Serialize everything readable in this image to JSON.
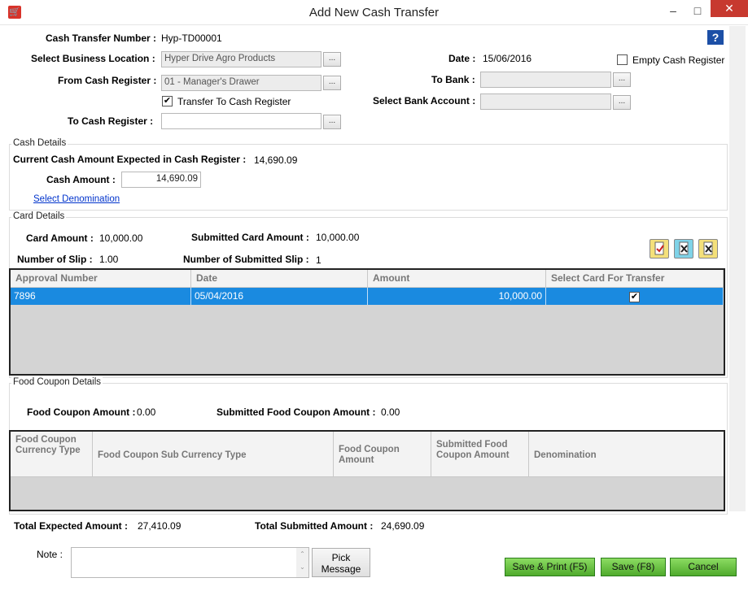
{
  "window": {
    "title": "Add New Cash Transfer",
    "minimize": "–",
    "maximize": "□",
    "close": "✕"
  },
  "header": {
    "transfer_number_label": "Cash Transfer Number :",
    "transfer_number_value": "Hyp-TD00001",
    "business_location_label": "Select Business Location :",
    "business_location_value": "Hyper Drive Agro Products",
    "from_register_label": "From Cash Register :",
    "from_register_value": "01 - Manager's Drawer",
    "transfer_to_register_label": "Transfer To Cash Register",
    "to_register_label": "To Cash Register :",
    "to_register_value": "",
    "date_label": "Date :",
    "date_value": "15/06/2016",
    "empty_register_label": "Empty Cash Register",
    "to_bank_label": "To Bank :",
    "to_bank_value": "",
    "bank_account_label": "Select Bank Account :",
    "bank_account_value": "",
    "ellipsis": "..."
  },
  "cash": {
    "group_label": "Cash Details",
    "expected_label": "Current Cash Amount Expected in Cash Register :",
    "expected_value": "14,690.09",
    "amount_label": "Cash Amount :",
    "amount_value": "14,690.09",
    "denomination_link": "Select Denomination"
  },
  "card": {
    "group_label": "Card Details",
    "card_amount_label": "Card Amount :",
    "card_amount_value": "10,000.00",
    "submitted_amount_label": "Submitted Card Amount :",
    "submitted_amount_value": "10,000.00",
    "slip_label": "Number of Slip :",
    "slip_value": "1.00",
    "submitted_slip_label": "Number of Submitted Slip :",
    "submitted_slip_value": "1",
    "columns": [
      "Approval Number",
      "Date",
      "Amount",
      "Select Card For Transfer"
    ],
    "rows": [
      {
        "approval": "7896",
        "date": "05/04/2016",
        "amount": "10,000.00",
        "selected": "✔"
      }
    ]
  },
  "coupon": {
    "group_label": "Food Coupon Details",
    "amount_label": "Food Coupon Amount :",
    "amount_value": "0.00",
    "submitted_label": "Submitted Food Coupon Amount :",
    "submitted_value": "0.00",
    "columns": [
      "Food Coupon Currency Type",
      "Food Coupon Sub Currency Type",
      "Food Coupon Amount",
      "Submitted Food Coupon Amount",
      "Denomination"
    ]
  },
  "totals": {
    "expected_label": "Total Expected Amount :",
    "expected_value": "27,410.09",
    "submitted_label": "Total Submitted Amount :",
    "submitted_value": "24,690.09"
  },
  "footer": {
    "note_label": "Note :",
    "note_value": "",
    "pick_message": "Pick Message",
    "save_print": "Save & Print (F5)",
    "save": "Save (F8)",
    "cancel": "Cancel"
  },
  "colors": {
    "selected_row": "#1a8ae0",
    "button_green": "#4faa2c",
    "close_red": "#c7392f"
  }
}
